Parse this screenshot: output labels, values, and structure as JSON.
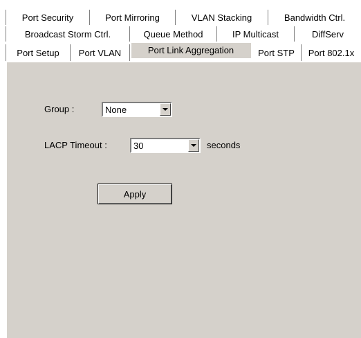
{
  "tabs": {
    "row1": [
      "Port Security",
      "Port Mirroring",
      "VLAN Stacking",
      "Bandwidth Ctrl."
    ],
    "row2": [
      "Broadcast Storm Ctrl.",
      "Queue Method",
      "IP Multicast",
      "DiffServ"
    ],
    "row3": [
      "Port Setup",
      "Port VLAN",
      "Port Link Aggregation",
      "Port STP",
      "Port 802.1x"
    ],
    "active": "Port Link Aggregation"
  },
  "form": {
    "group_label": "Group :",
    "group_value": "None",
    "lacp_label": "LACP Timeout :",
    "lacp_value": "30",
    "lacp_unit": "seconds",
    "apply_label": "Apply"
  },
  "colors": {
    "panel": "#d5d1cb"
  }
}
